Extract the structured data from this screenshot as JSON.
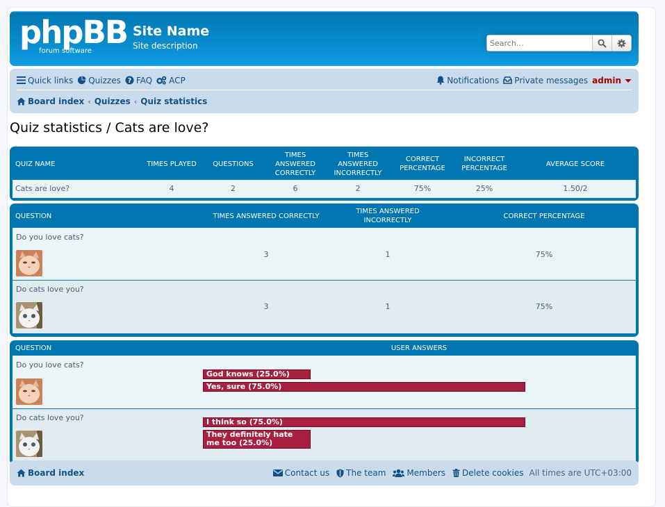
{
  "header": {
    "logo_main": "phpBB",
    "logo_sub": "forum software",
    "site_name": "Site Name",
    "site_description": "Site description",
    "search_placeholder": "Search…"
  },
  "nav": {
    "quick_links": "Quick links",
    "quizzes": "Quizzes",
    "faq": "FAQ",
    "acp": "ACP",
    "notifications": "Notifications",
    "private_messages": "Private messages",
    "username": "admin",
    "breadcrumb": [
      "Board index",
      "Quizzes",
      "Quiz statistics"
    ]
  },
  "page_title": "Quiz statistics / Cats are love?",
  "summary_table": {
    "headers": [
      "QUIZ NAME",
      "TIMES PLAYED",
      "QUESTIONS",
      "TIMES ANSWERED CORRECTLY",
      "TIMES ANSWERED INCORRECTLY",
      "CORRECT PERCENTAGE",
      "INCORRECT PERCENTAGE",
      "AVERAGE SCORE"
    ],
    "row": [
      "Cats are love?",
      "4",
      "2",
      "6",
      "2",
      "75%",
      "25%",
      "1.50/2"
    ]
  },
  "question_table": {
    "headers": [
      "QUESTION",
      "TIMES ANSWERED CORRECTLY",
      "TIMES ANSWERED INCORRECTLY",
      "CORRECT PERCENTAGE"
    ],
    "rows": [
      {
        "question": "Do you love cats?",
        "correct": "3",
        "incorrect": "1",
        "percentage": "75%"
      },
      {
        "question": "Do cats love you?",
        "correct": "3",
        "incorrect": "1",
        "percentage": "75%"
      }
    ]
  },
  "answers_table": {
    "headers": [
      "QUESTION",
      "USER ANSWERS"
    ],
    "rows": [
      {
        "question": "Do you love cats?",
        "answers": [
          {
            "label": "God knows (25.0%)",
            "share": 0.25
          },
          {
            "label": "Yes, sure (75.0%)",
            "share": 0.75
          }
        ]
      },
      {
        "question": "Do cats love you?",
        "answers": [
          {
            "label": "I think so (75.0%)",
            "share": 0.75
          },
          {
            "label": "They definitely hate me too (25.0%)",
            "share": 0.25
          }
        ]
      }
    ]
  },
  "footer": {
    "board_index": "Board index",
    "contact_us": "Contact us",
    "the_team": "The team",
    "members": "Members",
    "delete_cookies": "Delete cookies",
    "timezone": "All times are UTC+03:00"
  },
  "colors": {
    "header_blue": "#12a3eb",
    "nav_bg": "#cadceb",
    "link": "#105289",
    "bar_fill": "#a91f40",
    "admin_red": "#aa0000"
  }
}
